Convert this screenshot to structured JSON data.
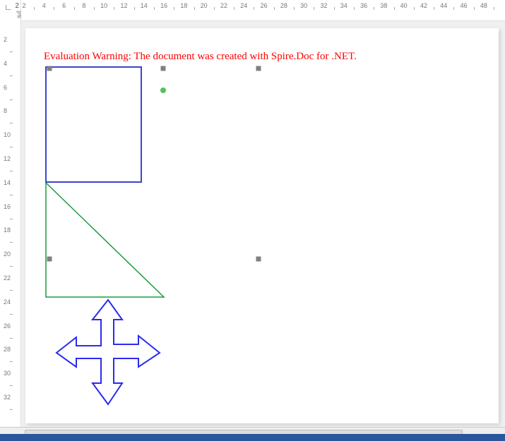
{
  "ruler": {
    "current_position": "2",
    "horizontal_ticks": [
      "2",
      "4",
      "6",
      "8",
      "10",
      "12",
      "14",
      "16",
      "18",
      "20",
      "22",
      "24",
      "26",
      "28",
      "30",
      "32",
      "34",
      "36",
      "38",
      "40",
      "42",
      "44",
      "46",
      "48"
    ],
    "vertical_ticks": [
      "2",
      "4",
      "6",
      "8",
      "10",
      "12",
      "14",
      "16",
      "18",
      "20",
      "22",
      "24",
      "26",
      "28",
      "30",
      "32"
    ]
  },
  "warning": {
    "text": "Evaluation Warning: The document was created with Spire.Doc for .NET.",
    "color": "#ff0000"
  },
  "shapes": {
    "rectangle": {
      "type": "rectangle",
      "stroke": "#3b44d1",
      "stroke_width": 2,
      "fill": "none",
      "selected": true
    },
    "triangle": {
      "type": "right-triangle",
      "stroke": "#1a9c3d",
      "stroke_width": 1,
      "fill": "none",
      "selected": true
    },
    "arrows": {
      "type": "quad-arrow",
      "stroke": "#2b2bee",
      "stroke_width": 2,
      "fill": "none",
      "selected": false
    }
  },
  "status_bar": {
    "text": ""
  }
}
